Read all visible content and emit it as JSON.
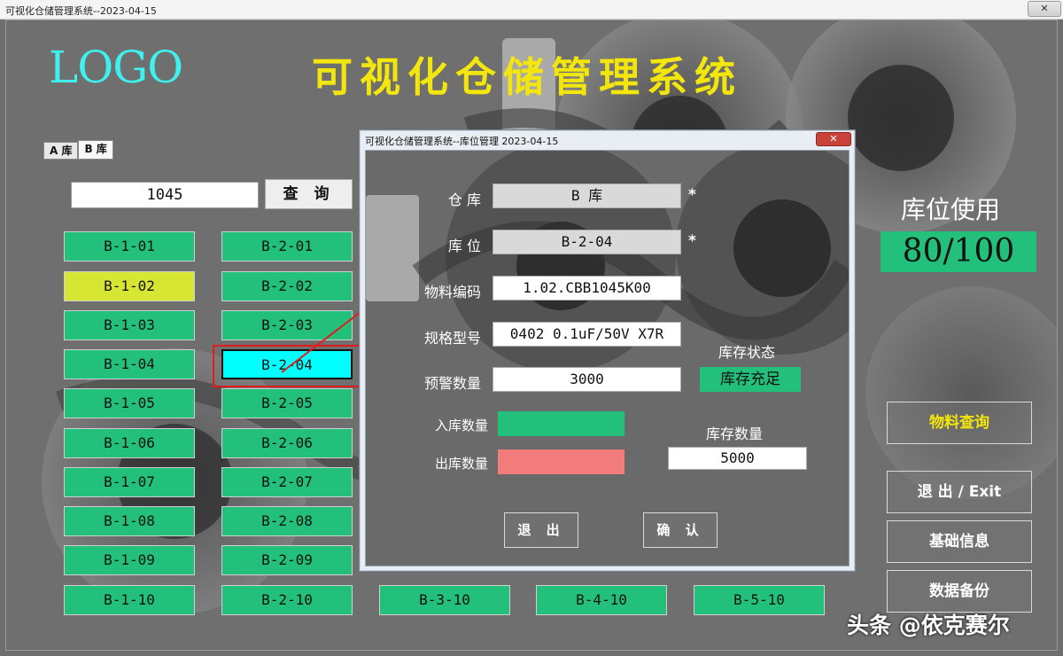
{
  "window": {
    "title": "可视化仓储管理系统--2023-04-15",
    "close_label": "✕"
  },
  "header": {
    "logo": "LOGO",
    "title": "可视化仓储管理系统"
  },
  "tabs": [
    {
      "label": "A 库"
    },
    {
      "label": "B 库"
    }
  ],
  "search": {
    "value": "1045",
    "button_label": "查 询"
  },
  "slots": {
    "col1": [
      "B-1-01",
      "B-1-02",
      "B-1-03",
      "B-1-04",
      "B-1-05",
      "B-1-06",
      "B-1-07",
      "B-1-08",
      "B-1-09",
      "B-1-10"
    ],
    "col2": [
      "B-2-01",
      "B-2-02",
      "B-2-03",
      "B-2-04",
      "B-2-05",
      "B-2-06",
      "B-2-07",
      "B-2-08",
      "B-2-09",
      "B-2-10"
    ],
    "bottom_row": [
      "B-3-10",
      "B-4-10",
      "B-5-10"
    ]
  },
  "colors": {
    "occupied": "#23c07b",
    "warning": "#d7e633",
    "selected": "#00ffff",
    "outbound": "#f27b7b"
  },
  "usage": {
    "label": "库位使用",
    "value": "80/100"
  },
  "side_buttons": {
    "material_query": "物料查询",
    "exit": "退 出 / Exit",
    "base_info": "基础信息",
    "backup": "数据备份"
  },
  "dialog": {
    "title": "可视化仓储管理系统--库位管理 2023-04-15",
    "close_label": "✕",
    "fields": {
      "warehouse_label": "仓  库",
      "warehouse_value": "B 库",
      "location_label": "库  位",
      "location_value": "B-2-04",
      "material_code_label": "物料编码",
      "material_code_value": "1.02.CBB1045K00",
      "spec_label": "规格型号",
      "spec_value": "0402 0.1uF/50V X7R",
      "alert_qty_label": "预警数量",
      "alert_qty_value": "3000",
      "in_qty_label": "入库数量",
      "out_qty_label": "出库数量",
      "required_mark": "*"
    },
    "stock_status_label": "库存状态",
    "stock_status_value": "库存充足",
    "stock_qty_label": "库存数量",
    "stock_qty_value": "5000",
    "exit_button": "退 出",
    "confirm_button": "确 认"
  },
  "watermark": "头条 @依克赛尔"
}
